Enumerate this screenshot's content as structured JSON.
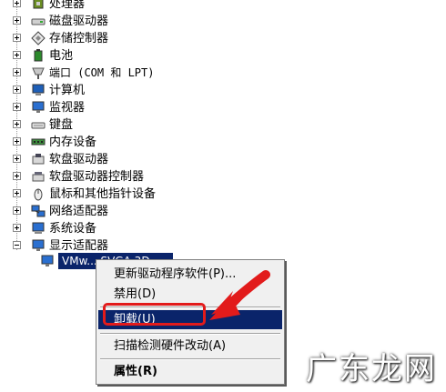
{
  "tree": {
    "items": [
      {
        "label": "处理器",
        "icon": "processor-icon",
        "expanded": false
      },
      {
        "label": "磁盘驱动器",
        "icon": "disk-drive-icon",
        "expanded": false
      },
      {
        "label": "存储控制器",
        "icon": "storage-controller-icon",
        "expanded": false
      },
      {
        "label": "电池",
        "icon": "battery-icon",
        "expanded": false
      },
      {
        "label": "端口 (COM 和 LPT)",
        "icon": "port-icon",
        "expanded": false
      },
      {
        "label": "计算机",
        "icon": "computer-icon",
        "expanded": false
      },
      {
        "label": "监视器",
        "icon": "monitor-icon",
        "expanded": false
      },
      {
        "label": "键盘",
        "icon": "keyboard-icon",
        "expanded": false
      },
      {
        "label": "内存设备",
        "icon": "memory-icon",
        "expanded": false
      },
      {
        "label": "软盘驱动器",
        "icon": "floppy-drive-icon",
        "expanded": false
      },
      {
        "label": "软盘驱动器控制器",
        "icon": "floppy-controller-icon",
        "expanded": false
      },
      {
        "label": "鼠标和其他指针设备",
        "icon": "mouse-icon",
        "expanded": false
      },
      {
        "label": "网络适配器",
        "icon": "network-adapter-icon",
        "expanded": false
      },
      {
        "label": "系统设备",
        "icon": "system-device-icon",
        "expanded": false
      },
      {
        "label": "显示适配器",
        "icon": "display-adapter-icon",
        "expanded": true
      }
    ],
    "selected_child": {
      "label": "VMw... SVGA 3D",
      "icon": "display-adapter-icon"
    }
  },
  "context_menu": {
    "items": [
      {
        "label": "更新驱动程序软件(P)...",
        "highlighted": false,
        "bold": false
      },
      {
        "label": "禁用(D)",
        "highlighted": false,
        "bold": false
      },
      {
        "label": "卸载(U)",
        "highlighted": true,
        "bold": false
      },
      {
        "label": "扫描检测硬件改动(A)",
        "highlighted": false,
        "bold": false
      },
      {
        "label": "属性(R)",
        "highlighted": false,
        "bold": true
      }
    ]
  },
  "annotation": {
    "color": "#e21b1b"
  },
  "watermark": {
    "text": "广东龙网"
  },
  "colors": {
    "selection": "#0a246a",
    "menu_bg": "#f0f0f0"
  }
}
